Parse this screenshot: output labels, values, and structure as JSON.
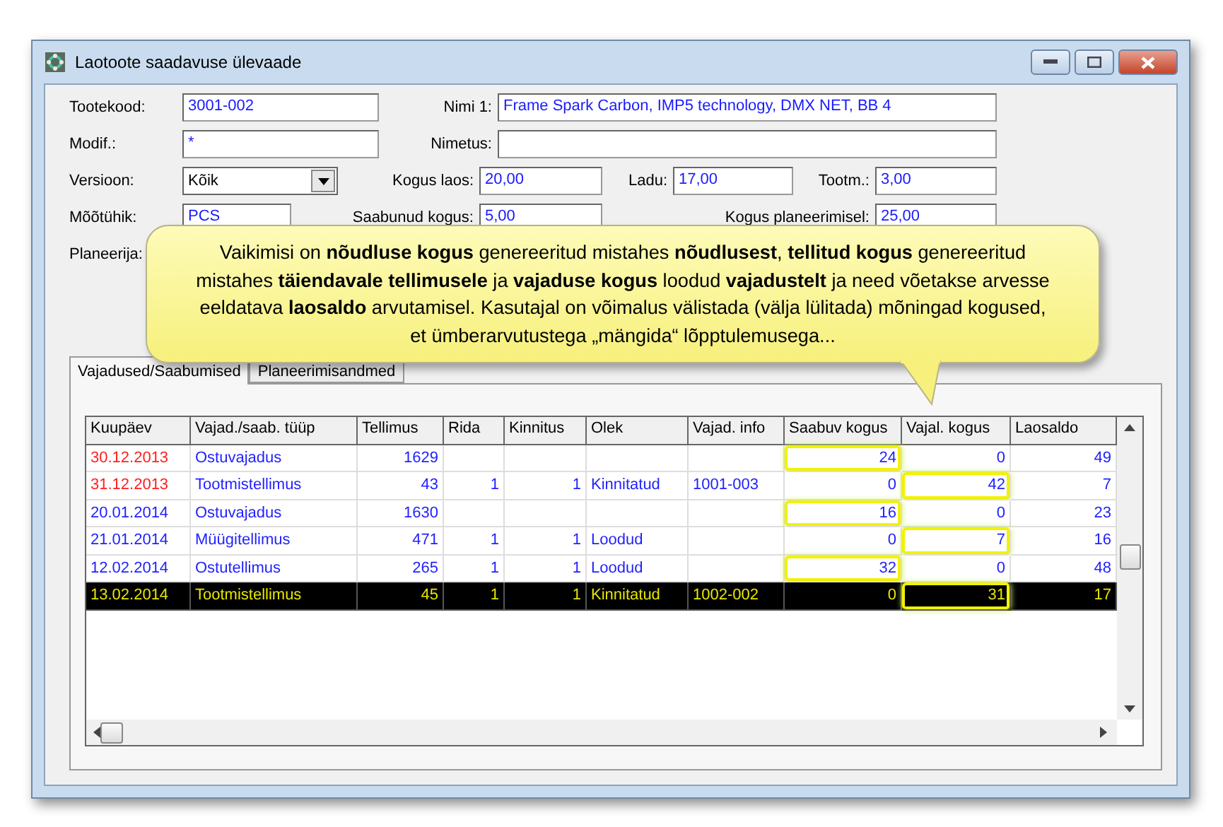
{
  "window": {
    "title": "Laotoote saadavuse ülevaade"
  },
  "form": {
    "rows": [
      [
        {
          "kind": "text",
          "label": "Tootekood:",
          "value": "3001-002"
        },
        {
          "kind": "text",
          "label": "Nimi 1:",
          "value": "Frame Spark Carbon, IMP5 technology, DMX NET, BB 4"
        }
      ],
      [
        {
          "kind": "text",
          "label": "Modif.:",
          "value": "*"
        },
        {
          "kind": "text",
          "label": "Nimetus:"
        }
      ],
      [
        {
          "kind": "combo",
          "label": "Versioon:",
          "value": "Kõik"
        },
        {
          "kind": "text",
          "label": "Kogus laos:",
          "value": "20,00"
        },
        {
          "kind": "text",
          "label": "Ladu:",
          "value": "17,00"
        },
        {
          "kind": "text",
          "label": "Tootm.:",
          "value": "3,00"
        }
      ],
      [
        {
          "kind": "text",
          "label": "Mõõtühik:",
          "value": "PCS"
        },
        {
          "kind": "text",
          "label": "Saabunud kogus:",
          "value": "5,00"
        },
        {
          "kind": "empty"
        },
        {
          "kind": "text",
          "label": "Kogus planeerimisel:",
          "value": "25,00"
        }
      ],
      [
        {
          "kind": "label",
          "label": "Planeerija:"
        }
      ]
    ]
  },
  "callout": {
    "text": "Vaikimisi on **nõudluse kogus** genereeritud mistahes **nõudlusest**, **tellitud kogus** genereeritud mistahes **täiendavale tellimusele** ja **vajaduse kogus** loodud **vajadustelt** ja need võetakse arvesse eeldatava **laosaldo** arvutamisel. Kasutajal on võimalus välistada (välja lülitada) mõningad kogused, et ümberarvutustega „mängida“ lõpptulemusega..."
  },
  "tabs": [
    {
      "label": "Vajadused/Saabumised",
      "selected": true
    },
    {
      "label": "Planeerimisandmed",
      "selected": false
    }
  ],
  "grid": {
    "columns": [
      "Kuupäev",
      "Vajad./saab. tüüp",
      "Tellimus",
      "Rida",
      "Kinnitus",
      "Olek",
      "Vajad. info",
      "Saabuv kogus",
      "Vajal. kogus",
      "Laosaldo"
    ],
    "rows": [
      {
        "overdue": true,
        "selected": false,
        "cells": [
          {
            "text": "30.12.2013"
          },
          {
            "text": "Ostuvajadus"
          },
          {
            "text": "1629"
          },
          {},
          {},
          {},
          {},
          {
            "text": "24",
            "highlighted": true
          },
          {
            "text": "0",
            "highlighted": false
          },
          {
            "text": "49"
          }
        ]
      },
      {
        "overdue": true,
        "selected": false,
        "cells": [
          {
            "text": "31.12.2013"
          },
          {
            "text": "Tootmistellimus"
          },
          {
            "text": "43"
          },
          {
            "text": "1"
          },
          {
            "text": "1"
          },
          {
            "text": "Kinnitatud"
          },
          {
            "text": "1001-003"
          },
          {
            "text": "0",
            "highlighted": false
          },
          {
            "text": "42",
            "highlighted": true
          },
          {
            "text": "7"
          }
        ]
      },
      {
        "overdue": false,
        "selected": false,
        "cells": [
          {
            "text": "20.01.2014"
          },
          {
            "text": "Ostuvajadus"
          },
          {
            "text": "1630"
          },
          {},
          {},
          {},
          {},
          {
            "text": "16",
            "highlighted": true
          },
          {
            "text": "0",
            "highlighted": false
          },
          {
            "text": "23"
          }
        ]
      },
      {
        "overdue": false,
        "selected": false,
        "cells": [
          {
            "text": "21.01.2014"
          },
          {
            "text": "Müügitellimus"
          },
          {
            "text": "471"
          },
          {
            "text": "1"
          },
          {
            "text": "1"
          },
          {
            "text": "Loodud"
          },
          {},
          {
            "text": "0",
            "highlighted": false
          },
          {
            "text": "7",
            "highlighted": true
          },
          {
            "text": "16"
          }
        ]
      },
      {
        "overdue": false,
        "selected": false,
        "cells": [
          {
            "text": "12.02.2014"
          },
          {
            "text": "Ostutellimus"
          },
          {
            "text": "265"
          },
          {
            "text": "1"
          },
          {
            "text": "1"
          },
          {
            "text": "Loodud"
          },
          {},
          {
            "text": "32",
            "highlighted": true
          },
          {
            "text": "0",
            "highlighted": false
          },
          {
            "text": "48"
          }
        ]
      },
      {
        "overdue": false,
        "selected": true,
        "cells": [
          {
            "text": "13.02.2014"
          },
          {
            "text": "Tootmistellimus"
          },
          {
            "text": "45"
          },
          {
            "text": "1"
          },
          {
            "text": "1"
          },
          {
            "text": "Kinnitatud"
          },
          {
            "text": "1002-002"
          },
          {
            "text": "0",
            "highlighted": false
          },
          {
            "text": "31",
            "highlighted": true
          },
          {
            "text": "17"
          }
        ]
      }
    ]
  }
}
